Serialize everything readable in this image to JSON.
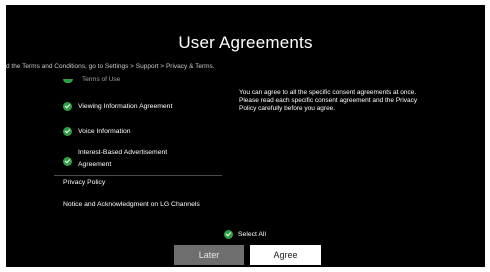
{
  "dialog": {
    "title": "User Agreements",
    "subtitle": "d the Terms and Conditions, go to Settings > Support > Privacy & Terms."
  },
  "agreements": {
    "peek_label": "Terms of Use",
    "items": [
      {
        "label_lines": [
          "Viewing Information Agreement"
        ],
        "checked": true
      },
      {
        "label_lines": [
          "Voice Information"
        ],
        "checked": true
      },
      {
        "label_lines": [
          "Interest-Based Advertisement",
          "Agreement"
        ],
        "checked": true
      }
    ],
    "links": [
      {
        "label": "Privacy Policy"
      },
      {
        "label": "Notice and Acknowledgment on LG Channels"
      }
    ]
  },
  "description": {
    "lines": [
      "You can agree to all the specific consent agreements at once.",
      "Please read each specific consent agreement and the Privacy",
      "Policy carefully before you agree."
    ]
  },
  "select_all": {
    "label": "Select All",
    "checked": true
  },
  "buttons": {
    "later_label": "Later",
    "agree_label": "Agree"
  },
  "colors": {
    "background": "#000000",
    "check_green": "#2ea043",
    "later_bg": "#6e6e6e",
    "agree_bg": "#ffffff"
  },
  "icons": {
    "checkbox": "check-circle-icon"
  }
}
